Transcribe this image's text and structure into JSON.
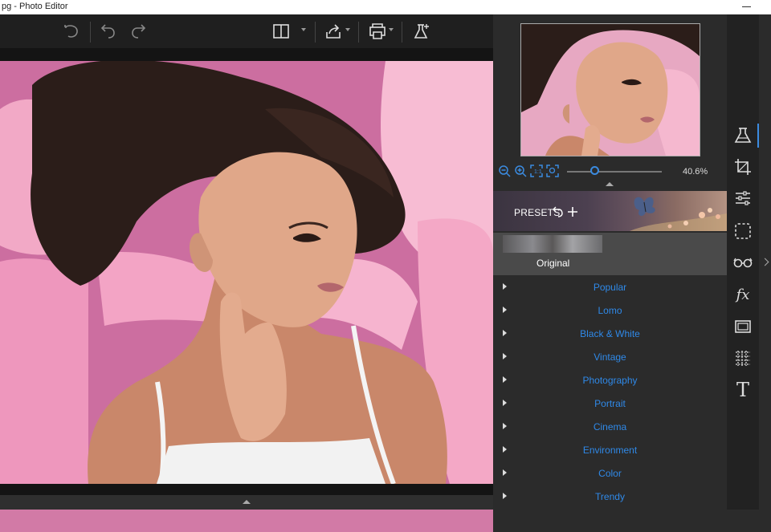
{
  "window": {
    "title": "pg - Photo Editor"
  },
  "toolbar": {
    "icons": [
      "undo-all-icon",
      "undo-icon",
      "redo-icon",
      "compare-icon",
      "share-icon",
      "print-icon",
      "lab-icon"
    ]
  },
  "navigator": {
    "zoom_value": "40.6%"
  },
  "presets": {
    "label": "PRESETS",
    "original_label": "Original",
    "categories": [
      "Popular",
      "Lomo",
      "Black & White",
      "Vintage",
      "Photography",
      "Portrait",
      "Cinema",
      "Environment",
      "Color",
      "Trendy"
    ]
  },
  "sidebar": {
    "tools": [
      "flask-icon",
      "crop-icon",
      "sliders-icon",
      "selection-icon",
      "glasses-icon",
      "fx-icon",
      "frame-icon",
      "texture-icon",
      "text-icon"
    ],
    "fx_label": "fx",
    "text_label": "T"
  },
  "colors": {
    "accent": "#3b8be0",
    "category_text": "#2f89e8",
    "panel_bg": "#2b2b2b",
    "toolbar_bg": "#1f1f1f"
  }
}
